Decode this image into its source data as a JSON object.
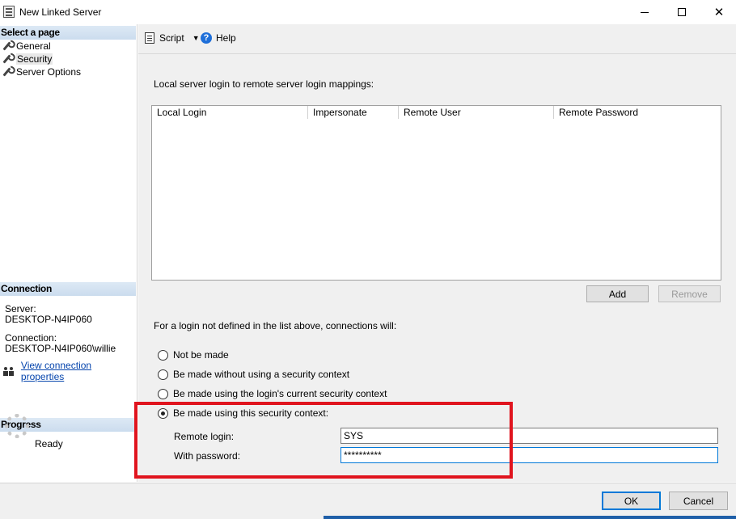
{
  "window": {
    "title": "New Linked Server"
  },
  "left_pane": {
    "select_page_header": "Select a page",
    "pages": [
      {
        "label": "General",
        "selected": false
      },
      {
        "label": "Security",
        "selected": true
      },
      {
        "label": "Server Options",
        "selected": false
      }
    ],
    "connection_header": "Connection",
    "server_label": "Server:",
    "server_value": "DESKTOP-N4IP060",
    "connection_label": "Connection:",
    "connection_value": "DESKTOP-N4IP060\\willie",
    "view_properties_link": "View connection properties",
    "progress_header": "Progress",
    "progress_status": "Ready"
  },
  "toolbar": {
    "script_label": "Script",
    "help_label": "Help"
  },
  "main": {
    "mappings_label": "Local server login to remote server login mappings:",
    "grid_columns": [
      "Local Login",
      "Impersonate",
      "Remote User",
      "Remote Password"
    ],
    "add_label": "Add",
    "remove_label": "Remove",
    "not_defined_label": "For a login not defined in the list above, connections will:",
    "options": [
      {
        "label": "Not be made",
        "checked": false
      },
      {
        "label": "Be made without using a security context",
        "checked": false
      },
      {
        "label": "Be made using the login's current security context",
        "checked": false
      },
      {
        "label": "Be made using this security context:",
        "checked": true
      }
    ],
    "remote_login_label": "Remote login:",
    "remote_login_value": "SYS",
    "password_label": "With password:",
    "password_value": "**********"
  },
  "footer": {
    "ok_label": "OK",
    "cancel_label": "Cancel"
  },
  "colors": {
    "highlight": "#e0141e",
    "accent": "#0078d7",
    "link": "#0645ad"
  }
}
